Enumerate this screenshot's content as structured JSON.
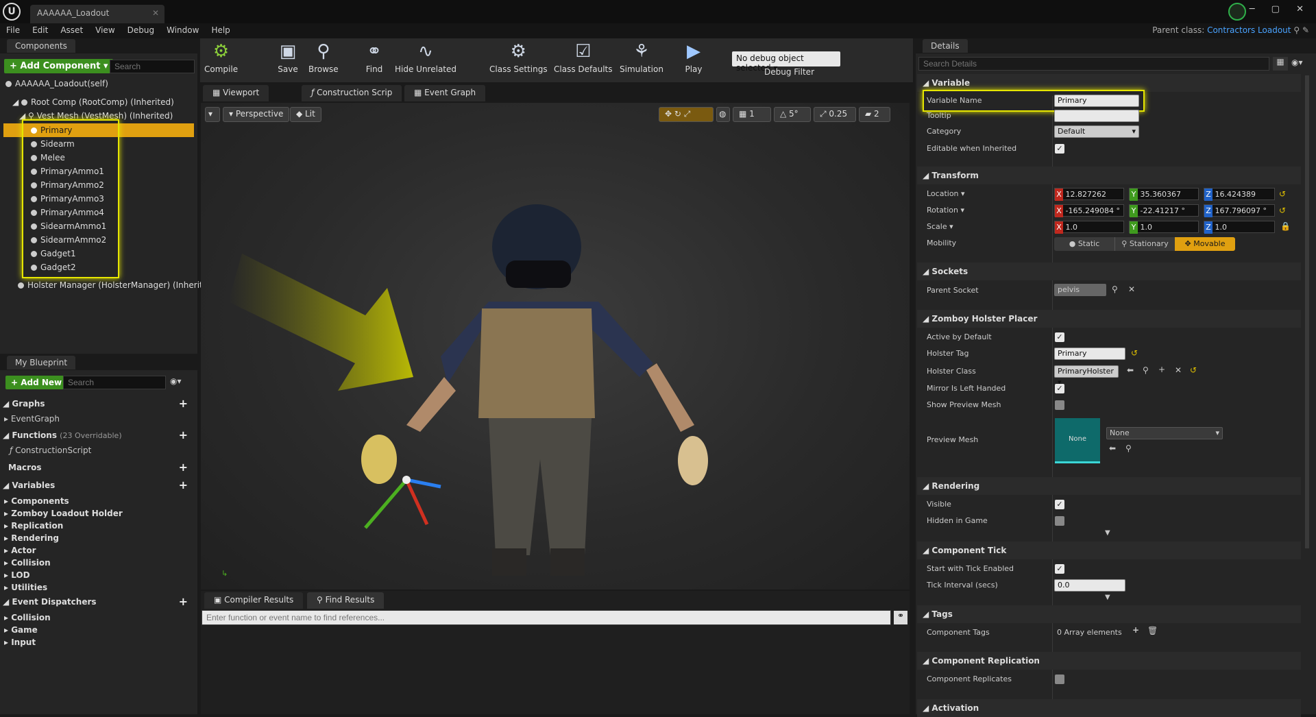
{
  "titlebar": {
    "doc_tab": "AAAAAA_Loadout",
    "window_buttons": "─ ▢ ✕"
  },
  "menu": [
    "File",
    "Edit",
    "Asset",
    "View",
    "Debug",
    "Window",
    "Help"
  ],
  "parent_class": {
    "label": "Parent class:",
    "value": "Contractors Loadout"
  },
  "components": {
    "tab": "Components",
    "add_label": "+ Add Component ▾",
    "search_placeholder": "Search",
    "self_label": "AAAAAA_Loadout(self)",
    "root": "Root Comp (RootComp) (Inherited)",
    "vest": "Vest Mesh (VestMesh) (Inherited)",
    "children": [
      "Primary",
      "Sidearm",
      "Melee",
      "PrimaryAmmo1",
      "PrimaryAmmo2",
      "PrimaryAmmo3",
      "PrimaryAmmo4",
      "SidearmAmmo1",
      "SidearmAmmo2",
      "Gadget1",
      "Gadget2"
    ],
    "selected": "Primary",
    "holster": "Holster Manager (HolsterManager) (Inherited"
  },
  "blueprint": {
    "tab": "My Blueprint",
    "add_label": "+ Add New ▾",
    "search_placeholder": "Search",
    "graphs": "Graphs",
    "eventgraph": "EventGraph",
    "functions": "Functions",
    "functions_count": "(23 Overridable)",
    "construction": "ConstructionScript",
    "macros": "Macros",
    "variables": "Variables",
    "variable_cats": [
      "Components",
      "Zomboy Loadout Holder",
      "Replication",
      "Rendering",
      "Actor",
      "Collision",
      "LOD",
      "Utilities"
    ],
    "dispatchers": "Event Dispatchers",
    "dispatcher_cats": [
      "Collision",
      "Game",
      "Input"
    ]
  },
  "toolbar": {
    "compile": "Compile",
    "save": "Save",
    "browse": "Browse",
    "find": "Find",
    "hide_unrelated": "Hide Unrelated",
    "class_settings": "Class Settings",
    "class_defaults": "Class Defaults",
    "simulation": "Simulation",
    "play": "Play",
    "debug_select": "No debug object selected ▾",
    "debug_filter": "Debug Filter"
  },
  "editor_tabs": [
    "Viewport",
    "Construction Scrip",
    "Event Graph"
  ],
  "viewport": {
    "perspective": "Perspective",
    "lit": "Lit",
    "grid_val": "1",
    "angle_val": "5°",
    "scale_val": "0.25",
    "cam_speed": "2"
  },
  "bottom": {
    "tabs": [
      "Compiler Results",
      "Find Results"
    ],
    "find_placeholder": "Enter function or event name to find references..."
  },
  "details": {
    "tab": "Details",
    "search_placeholder": "Search Details",
    "variable": {
      "title": "Variable",
      "name_label": "Variable Name",
      "name_value": "Primary",
      "tooltip_label": "Tooltip",
      "category_label": "Category",
      "category_value": "Default",
      "editable_label": "Editable when Inherited"
    },
    "transform": {
      "title": "Transform",
      "location": "Location ▾",
      "rotation": "Rotation ▾",
      "scale": "Scale ▾",
      "mobility": "Mobility",
      "loc": [
        "12.827262",
        "35.360367",
        "16.424389"
      ],
      "rot": [
        "-165.249084 °",
        "-22.41217 °",
        "167.796097 °"
      ],
      "scl": [
        "1.0",
        "1.0",
        "1.0"
      ],
      "mob": [
        "Static",
        "Stationary",
        "Movable"
      ]
    },
    "sockets": {
      "title": "Sockets",
      "parent_label": "Parent Socket",
      "parent_value": "pelvis"
    },
    "holster": {
      "title": "Zomboy Holster Placer",
      "active": "Active by Default",
      "tag_label": "Holster Tag",
      "tag_value": "Primary",
      "class_label": "Holster Class",
      "class_value": "PrimaryHolster ▾",
      "mirror": "Mirror Is Left Handed",
      "show_preview": "Show Preview Mesh",
      "preview_label": "Preview Mesh",
      "preview_thumb": "None",
      "preview_value": "None"
    },
    "rendering": {
      "title": "Rendering",
      "visible": "Visible",
      "hidden": "Hidden in Game"
    },
    "tick": {
      "title": "Component Tick",
      "start": "Start with Tick Enabled",
      "interval_label": "Tick Interval (secs)",
      "interval_value": "0.0"
    },
    "tags": {
      "title": "Tags",
      "label": "Component Tags",
      "value": "0 Array elements"
    },
    "replication": {
      "title": "Component Replication",
      "label": "Component Replicates"
    },
    "activation": {
      "title": "Activation"
    }
  },
  "colors": {
    "accent": "#e0a010",
    "highlight": "#e6e600",
    "green": "#3c8f1f"
  }
}
